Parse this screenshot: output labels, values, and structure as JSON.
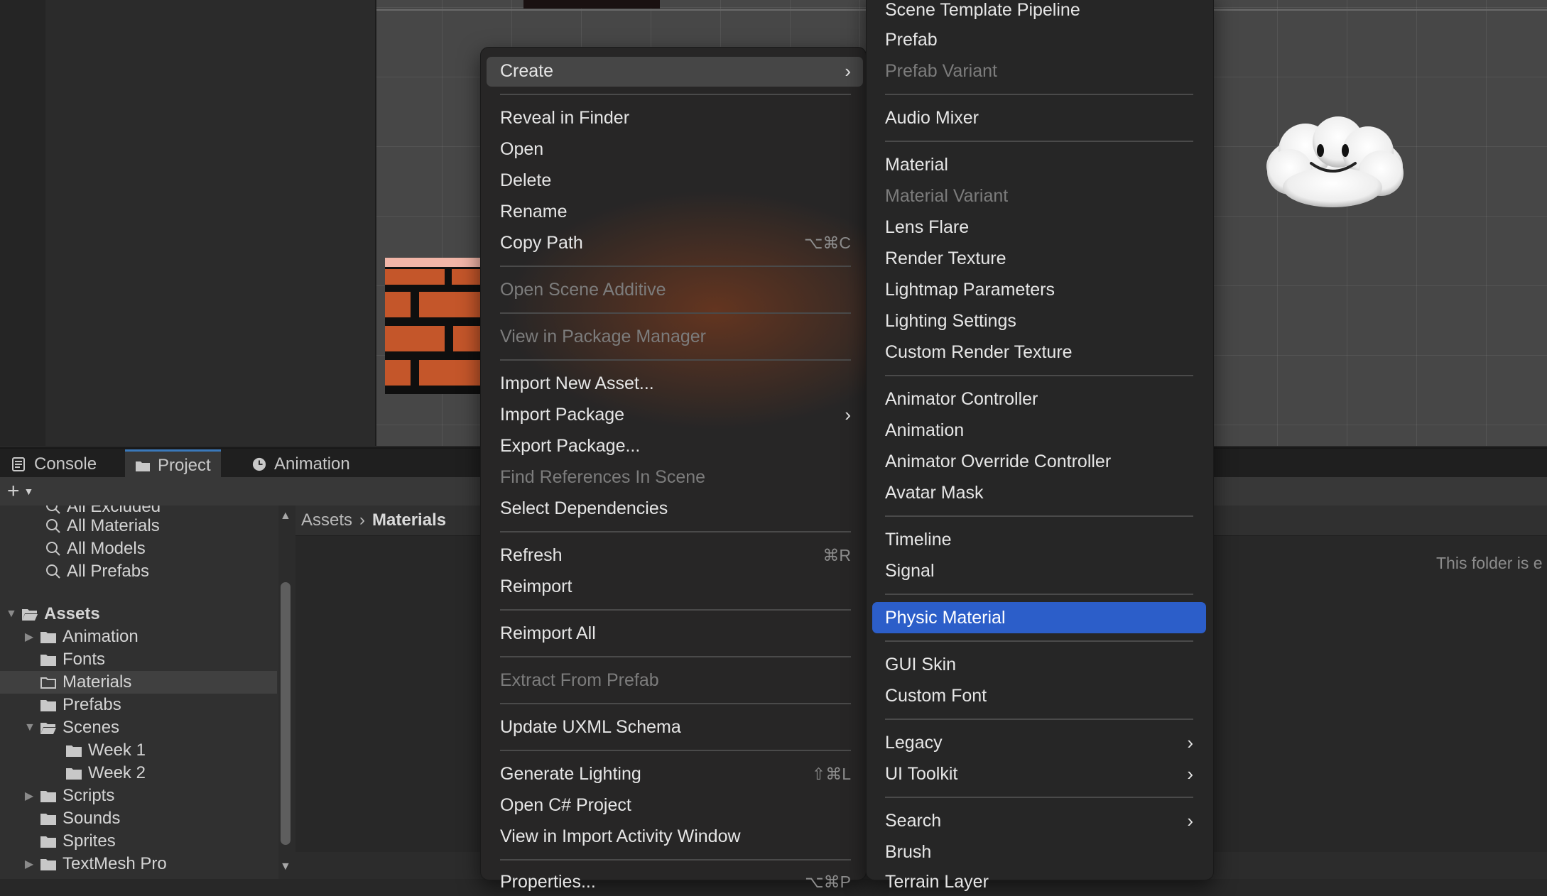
{
  "tabs": [
    {
      "label": "Console",
      "icon": "console-icon"
    },
    {
      "label": "Project",
      "icon": "folder-icon"
    },
    {
      "label": "Animation",
      "icon": "clock-icon"
    }
  ],
  "toolbar": {
    "add_label": "+",
    "add_icon": "plus-icon"
  },
  "tree": {
    "cut_item": "All Excluded",
    "search_items": [
      "All Materials",
      "All Models",
      "All Prefabs"
    ],
    "root": "Assets",
    "folders": [
      "Animation",
      "Fonts",
      "Materials",
      "Prefabs",
      "Scenes",
      "Week 1",
      "Week 2",
      "Scripts",
      "Sounds",
      "Sprites",
      "TextMesh Pro"
    ],
    "selected": "Materials"
  },
  "breadcrumb": {
    "root": "Assets",
    "current": "Materials"
  },
  "content": {
    "empty_text": "This folder is e"
  },
  "context_menu": {
    "create": "Create",
    "reveal_in_finder": "Reveal in Finder",
    "open": "Open",
    "delete": "Delete",
    "rename": "Rename",
    "copy_path": "Copy Path",
    "copy_path_shortcut": "⌥⌘C",
    "open_scene_additive": "Open Scene Additive",
    "view_in_package_manager": "View in Package Manager",
    "import_new_asset": "Import New Asset...",
    "import_package": "Import Package",
    "export_package": "Export Package...",
    "find_references": "Find References In Scene",
    "select_dependencies": "Select Dependencies",
    "refresh": "Refresh",
    "refresh_shortcut": "⌘R",
    "reimport": "Reimport",
    "reimport_all": "Reimport All",
    "extract_from_prefab": "Extract From Prefab",
    "update_uxml_schema": "Update UXML Schema",
    "generate_lighting": "Generate Lighting",
    "generate_lighting_shortcut": "⇧⌘L",
    "open_csharp_project": "Open C# Project",
    "view_in_import_activity": "View in Import Activity Window",
    "properties_cut": "Properties...",
    "properties_shortcut_cut": "⌥⌘P"
  },
  "create_submenu": {
    "scene_template_pipeline": "Scene Template Pipeline",
    "prefab": "Prefab",
    "prefab_variant": "Prefab Variant",
    "audio_mixer": "Audio Mixer",
    "material": "Material",
    "material_variant": "Material Variant",
    "lens_flare": "Lens Flare",
    "render_texture": "Render Texture",
    "lightmap_parameters": "Lightmap Parameters",
    "lighting_settings": "Lighting Settings",
    "custom_render_texture": "Custom Render Texture",
    "animator_controller": "Animator Controller",
    "animation": "Animation",
    "animator_override_controller": "Animator Override Controller",
    "avatar_mask": "Avatar Mask",
    "timeline": "Timeline",
    "signal": "Signal",
    "physic_material": "Physic Material",
    "gui_skin": "GUI Skin",
    "custom_font": "Custom Font",
    "legacy": "Legacy",
    "ui_toolkit": "UI Toolkit",
    "search": "Search",
    "brush": "Brush",
    "terrain_cut": "Terrain Layer"
  },
  "colors": {
    "highlight": "#2c5ec9",
    "tab_accent": "#3a79bb",
    "brick": "#c4562a"
  }
}
